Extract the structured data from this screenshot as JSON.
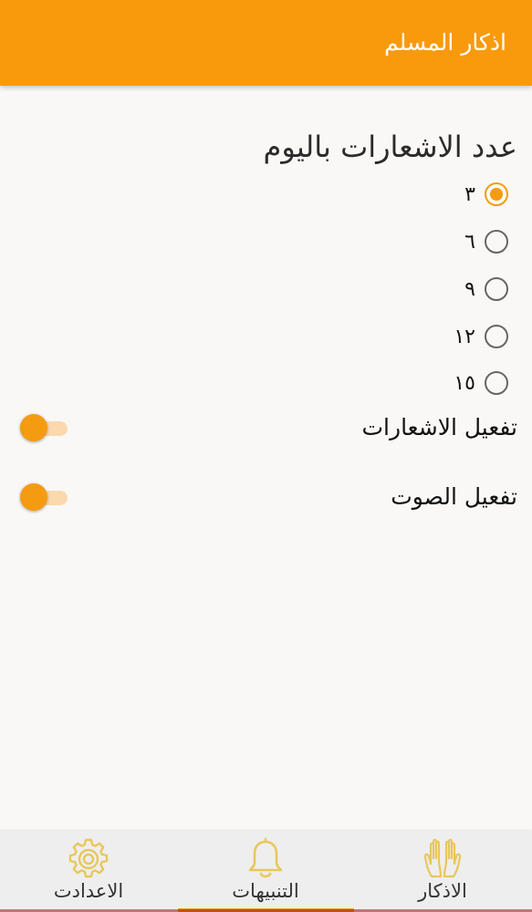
{
  "app_bar": {
    "title": "اذكار المسلم"
  },
  "settings": {
    "heading": "عدد الاشعارات باليوم",
    "options": [
      {
        "label": "٣",
        "selected": true
      },
      {
        "label": "٦",
        "selected": false
      },
      {
        "label": "٩",
        "selected": false
      },
      {
        "label": "١٢",
        "selected": false
      },
      {
        "label": "١٥",
        "selected": false
      }
    ],
    "notifications_toggle": {
      "label": "تفعيل الاشعارات",
      "on": true
    },
    "sound_toggle": {
      "label": "تفعيل الصوت",
      "on": true
    }
  },
  "bottom_nav": {
    "items": [
      {
        "label": "الاعدادت",
        "icon": "gear-icon"
      },
      {
        "label": "التنبيهات",
        "icon": "bell-icon",
        "active": true
      },
      {
        "label": "الاذكار",
        "icon": "praying-hands-icon"
      }
    ]
  },
  "colors": {
    "accent": "#f99a0c",
    "icon_gold": "#e8c75c",
    "background": "#faf8f6"
  }
}
